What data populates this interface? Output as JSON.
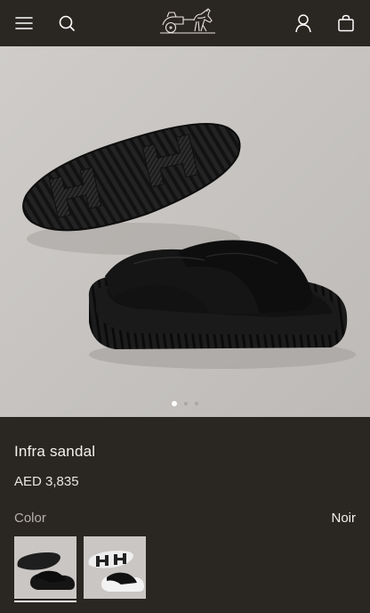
{
  "header": {
    "menu_icon": "hamburger-menu-icon",
    "search_icon": "search-icon",
    "logo": "hermes-carriage-logo",
    "account_icon": "user-icon",
    "cart_icon": "shopping-bag-icon"
  },
  "gallery": {
    "image_description": "black cross-strap slide sandal with sculpted rubber sole",
    "pager": {
      "current": 1,
      "total": 3
    }
  },
  "product": {
    "name": "Infra sandal",
    "price": "AED 3,835",
    "color_label": "Color",
    "color_value": "Noir",
    "swatches": [
      {
        "name": "Noir",
        "selected": true
      },
      {
        "name": "Blanc/Noir",
        "selected": false
      }
    ]
  },
  "colors": {
    "header_bg": "#2a2622",
    "hero_bg": "#c6c3c0",
    "text_primary": "#f4f1ed",
    "text_muted": "#b8b1a9"
  }
}
